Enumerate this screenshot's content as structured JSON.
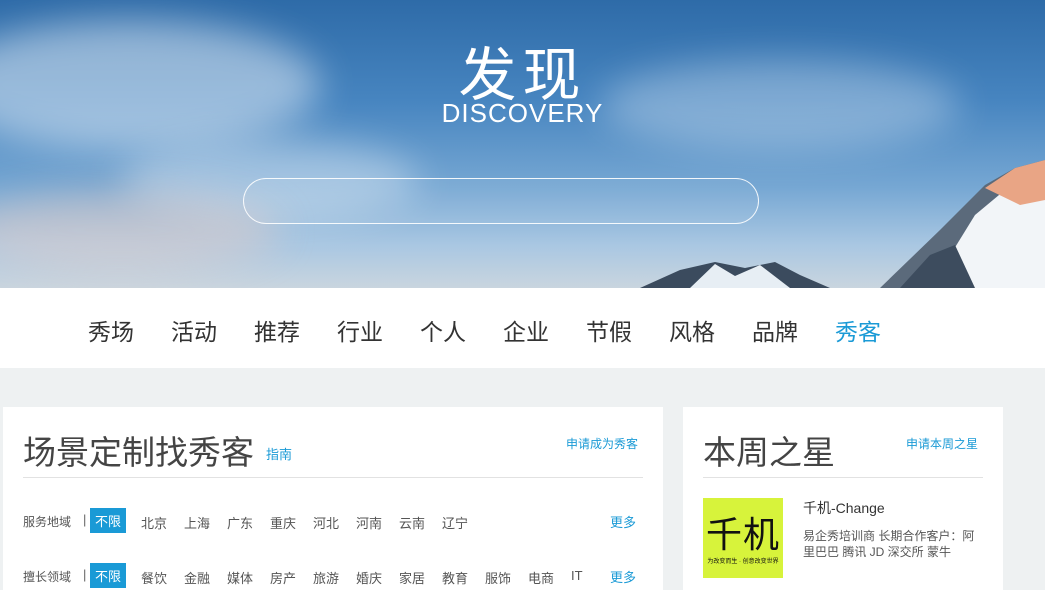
{
  "hero": {
    "title": "发现",
    "subtitle": "DISCOVERY",
    "search_placeholder": ""
  },
  "nav": {
    "items": [
      "秀场",
      "活动",
      "推荐",
      "行业",
      "个人",
      "企业",
      "节假",
      "风格",
      "品牌",
      "秀客"
    ],
    "active": "秀客"
  },
  "left_panel": {
    "title": "场景定制找秀客",
    "guide": "指南",
    "apply": "申请成为秀客",
    "filters": [
      {
        "label": "服务地域",
        "separator": "|",
        "options": [
          "不限",
          "北京",
          "上海",
          "广东",
          "重庆",
          "河北",
          "河南",
          "云南",
          "辽宁"
        ],
        "selected": "不限",
        "more": "更多"
      },
      {
        "label": "擅长领域",
        "separator": "|",
        "options": [
          "不限",
          "餐饮",
          "金融",
          "媒体",
          "房产",
          "旅游",
          "婚庆",
          "家居",
          "教育",
          "服饰",
          "电商",
          "IT"
        ],
        "selected": "不限",
        "more": "更多"
      }
    ]
  },
  "right_panel": {
    "title": "本周之星",
    "apply": "申请本周之星",
    "star": {
      "logo_text": "千机",
      "logo_subtext": "为改变而生 · 创意改变世界",
      "name": "千机-Change",
      "description": "易企秀培训商 长期合作客户：阿里巴巴 腾讯 JD 深交所 蒙牛"
    }
  },
  "colors": {
    "accent": "#1a9ad6",
    "logo_bg": "#d7f33b",
    "page_bg": "#eef1f2"
  }
}
